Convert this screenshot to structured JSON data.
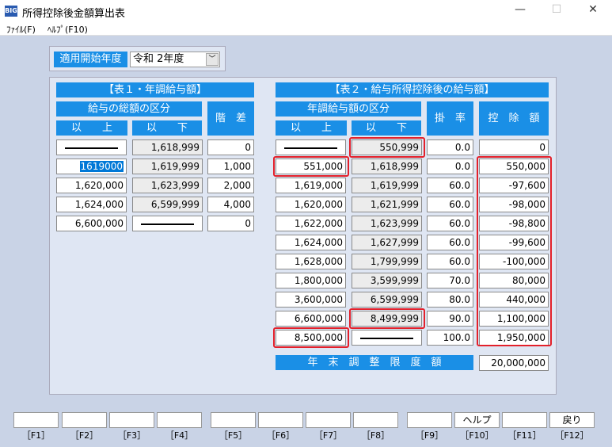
{
  "window": {
    "icon_text": "BIG",
    "title": "所得控除後金額算出表",
    "minimize": "—",
    "maximize": "☐",
    "close": "✕"
  },
  "menu": {
    "file": "ﾌｧｲﾙ(F)",
    "help": "ﾍﾙﾌﾟ(F10)"
  },
  "year": {
    "label": "適用開始年度",
    "value": "令和 2年度",
    "arrow": "﹀"
  },
  "table1": {
    "title": "【表１・年調給与額】",
    "group": "給与の総額の区分",
    "col_from": "以　　上",
    "col_to": "以　　下",
    "col_diff": "階　差",
    "rows": [
      {
        "from": "",
        "to": "1,618,999",
        "diff": "0"
      },
      {
        "from": "1619000",
        "to": "1,619,999",
        "diff": "1,000"
      },
      {
        "from": "1,620,000",
        "to": "1,623,999",
        "diff": "2,000"
      },
      {
        "from": "1,624,000",
        "to": "6,599,999",
        "diff": "4,000"
      },
      {
        "from": "6,600,000",
        "to": "",
        "diff": "0"
      }
    ]
  },
  "table2": {
    "title": "【表２・給与所得控除後の給与額】",
    "group": "年調給与額の区分",
    "col_from": "以　　上",
    "col_to": "以　　下",
    "col_rate": "掛　率",
    "col_deduct": "控　除　額",
    "rows": [
      {
        "from": "",
        "to": "550,999",
        "rate": "0.0",
        "deduct": "0"
      },
      {
        "from": "551,000",
        "to": "1,618,999",
        "rate": "0.0",
        "deduct": "550,000"
      },
      {
        "from": "1,619,000",
        "to": "1,619,999",
        "rate": "60.0",
        "deduct": "-97,600"
      },
      {
        "from": "1,620,000",
        "to": "1,621,999",
        "rate": "60.0",
        "deduct": "-98,000"
      },
      {
        "from": "1,622,000",
        "to": "1,623,999",
        "rate": "60.0",
        "deduct": "-98,800"
      },
      {
        "from": "1,624,000",
        "to": "1,627,999",
        "rate": "60.0",
        "deduct": "-99,600"
      },
      {
        "from": "1,628,000",
        "to": "1,799,999",
        "rate": "60.0",
        "deduct": "-100,000"
      },
      {
        "from": "1,800,000",
        "to": "3,599,999",
        "rate": "70.0",
        "deduct": "80,000"
      },
      {
        "from": "3,600,000",
        "to": "6,599,999",
        "rate": "80.0",
        "deduct": "440,000"
      },
      {
        "from": "6,600,000",
        "to": "8,499,999",
        "rate": "90.0",
        "deduct": "1,100,000"
      },
      {
        "from": "8,500,000",
        "to": "",
        "rate": "100.0",
        "deduct": "1,950,000"
      }
    ],
    "limit_label": "年　末　調　整　限　度　額",
    "limit_value": "20,000,000"
  },
  "fkeys": [
    {
      "label": "",
      "key": "［F1］"
    },
    {
      "label": "",
      "key": "［F2］"
    },
    {
      "label": "",
      "key": "［F3］"
    },
    {
      "label": "",
      "key": "［F4］"
    },
    {
      "label": "",
      "key": "［F5］"
    },
    {
      "label": "",
      "key": "［F6］"
    },
    {
      "label": "",
      "key": "［F7］"
    },
    {
      "label": "",
      "key": "［F8］"
    },
    {
      "label": "",
      "key": "［F9］"
    },
    {
      "label": "ヘルプ",
      "key": "［F10］"
    },
    {
      "label": "",
      "key": "［F11］"
    },
    {
      "label": "戻り",
      "key": "［F12］"
    }
  ]
}
